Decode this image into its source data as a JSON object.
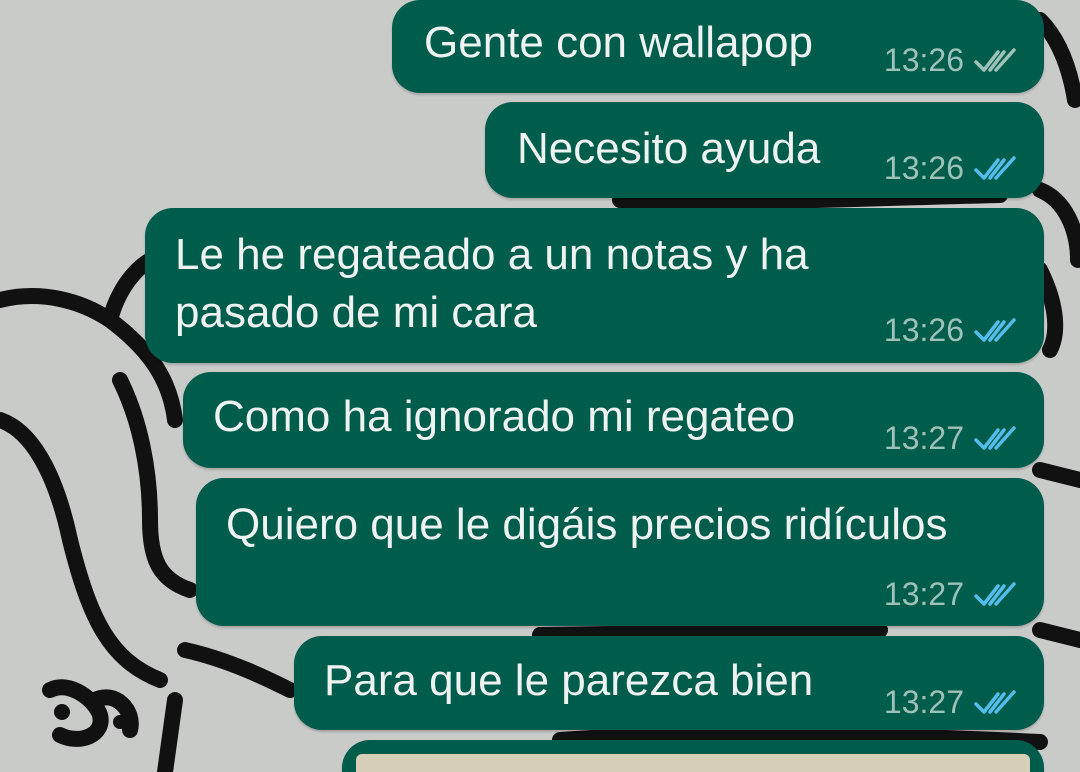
{
  "colors": {
    "bubble_outgoing": "#005c4b",
    "wallpaper": "#c9cbc9",
    "text": "#eef3f1",
    "time": "#9fc2b8",
    "ticks_read": "#53bdeb",
    "ticks_delivered": "#9fc2b8"
  },
  "messages": [
    {
      "text": "Gente con wallapop",
      "time": "13:26",
      "status_icon": "double-check-icon",
      "status": "delivered"
    },
    {
      "text": "Necesito ayuda",
      "time": "13:26",
      "status_icon": "double-check-icon",
      "status": "read"
    },
    {
      "text": "Le he regateado a un notas y ha\npasado de mi cara",
      "time": "13:26",
      "status_icon": "double-check-icon",
      "status": "read"
    },
    {
      "text": "Como ha ignorado mi regateo",
      "time": "13:27",
      "status_icon": "double-check-icon",
      "status": "read"
    },
    {
      "text": "Quiero que le digáis precios ridículos",
      "time": "13:27",
      "status_icon": "double-check-icon",
      "status": "read"
    },
    {
      "text": "Para que le parezca bien",
      "time": "13:27",
      "status_icon": "double-check-icon",
      "status": "read"
    }
  ]
}
